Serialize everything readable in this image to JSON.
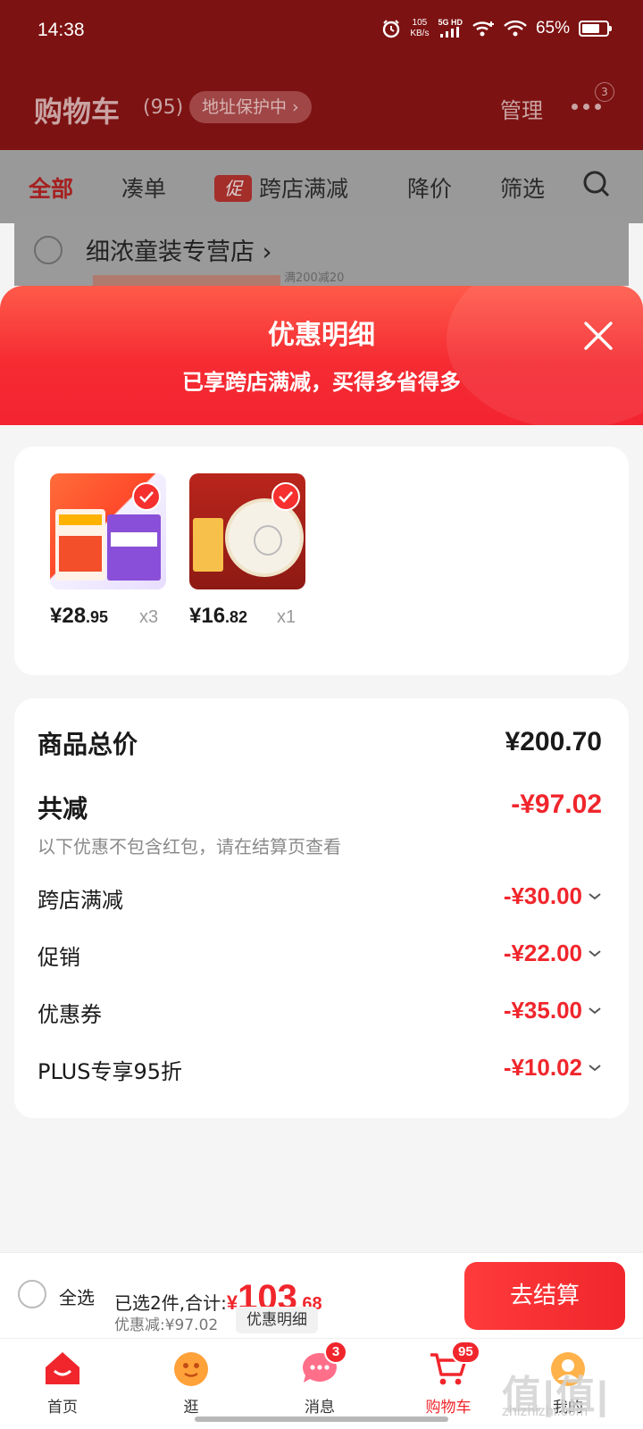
{
  "status_bar": {
    "time": "14:38",
    "speed": "105",
    "speed_unit": "KB/s",
    "network": "5G HD",
    "battery": "65%"
  },
  "header": {
    "title": "购物车",
    "count": "(95)",
    "address_pill": "地址保护中 ›",
    "manage": "管理",
    "more_badge": "3"
  },
  "tabs": {
    "all": "全部",
    "bundle": "凑单",
    "promo_tag": "促",
    "cross_store": "跨店满减",
    "price_drop": "降价",
    "filter": "筛选"
  },
  "store": {
    "name": "细浓童装专营店 ›",
    "peek_text": "满200减20"
  },
  "sheet": {
    "title": "优惠明细",
    "subtitle": "已享跨店满减，买得多省得多"
  },
  "products": [
    {
      "price_int": "¥28",
      "price_dec": ".95",
      "qty": "x3",
      "brand_color": "#8a4fd8"
    },
    {
      "price_int": "¥16",
      "price_dec": ".82",
      "qty": "x1",
      "brand_color": "#b9251c"
    }
  ],
  "summary": {
    "total_label": "商品总价",
    "total_value": "¥200.70",
    "reduce_label": "共减",
    "reduce_value": "-¥97.02",
    "note": "以下优惠不包含红包，请在结算页查看",
    "items": [
      {
        "label": "跨店满减",
        "value": "-¥30.00"
      },
      {
        "label": "促销",
        "value": "-¥22.00"
      },
      {
        "label": "优惠券",
        "value": "-¥35.00"
      },
      {
        "label": "PLUS专享95折",
        "value": "-¥10.02"
      }
    ]
  },
  "checkout": {
    "select_all": "全选",
    "selected_text": "已选2件,合计:",
    "yen": "¥",
    "amount_int": "103",
    "amount_dec": ".68",
    "discount_text": "优惠减:¥97.02",
    "detail_chip": "优惠明细",
    "button": "去结算"
  },
  "bottom_nav": {
    "items": [
      {
        "label": "首页",
        "icon": "home-icon"
      },
      {
        "label": "逛",
        "icon": "browse-icon"
      },
      {
        "label": "消息",
        "icon": "message-icon",
        "badge": "3"
      },
      {
        "label": "购物车",
        "icon": "cart-icon",
        "badge": "95"
      },
      {
        "label": "我的",
        "icon": "profile-icon"
      }
    ]
  },
  "watermark": {
    "mark": "值|值|值",
    "site": "zhizhizhi.com"
  },
  "colors": {
    "accent_red": "#f0262c",
    "header_dark_red": "#7d1212"
  }
}
